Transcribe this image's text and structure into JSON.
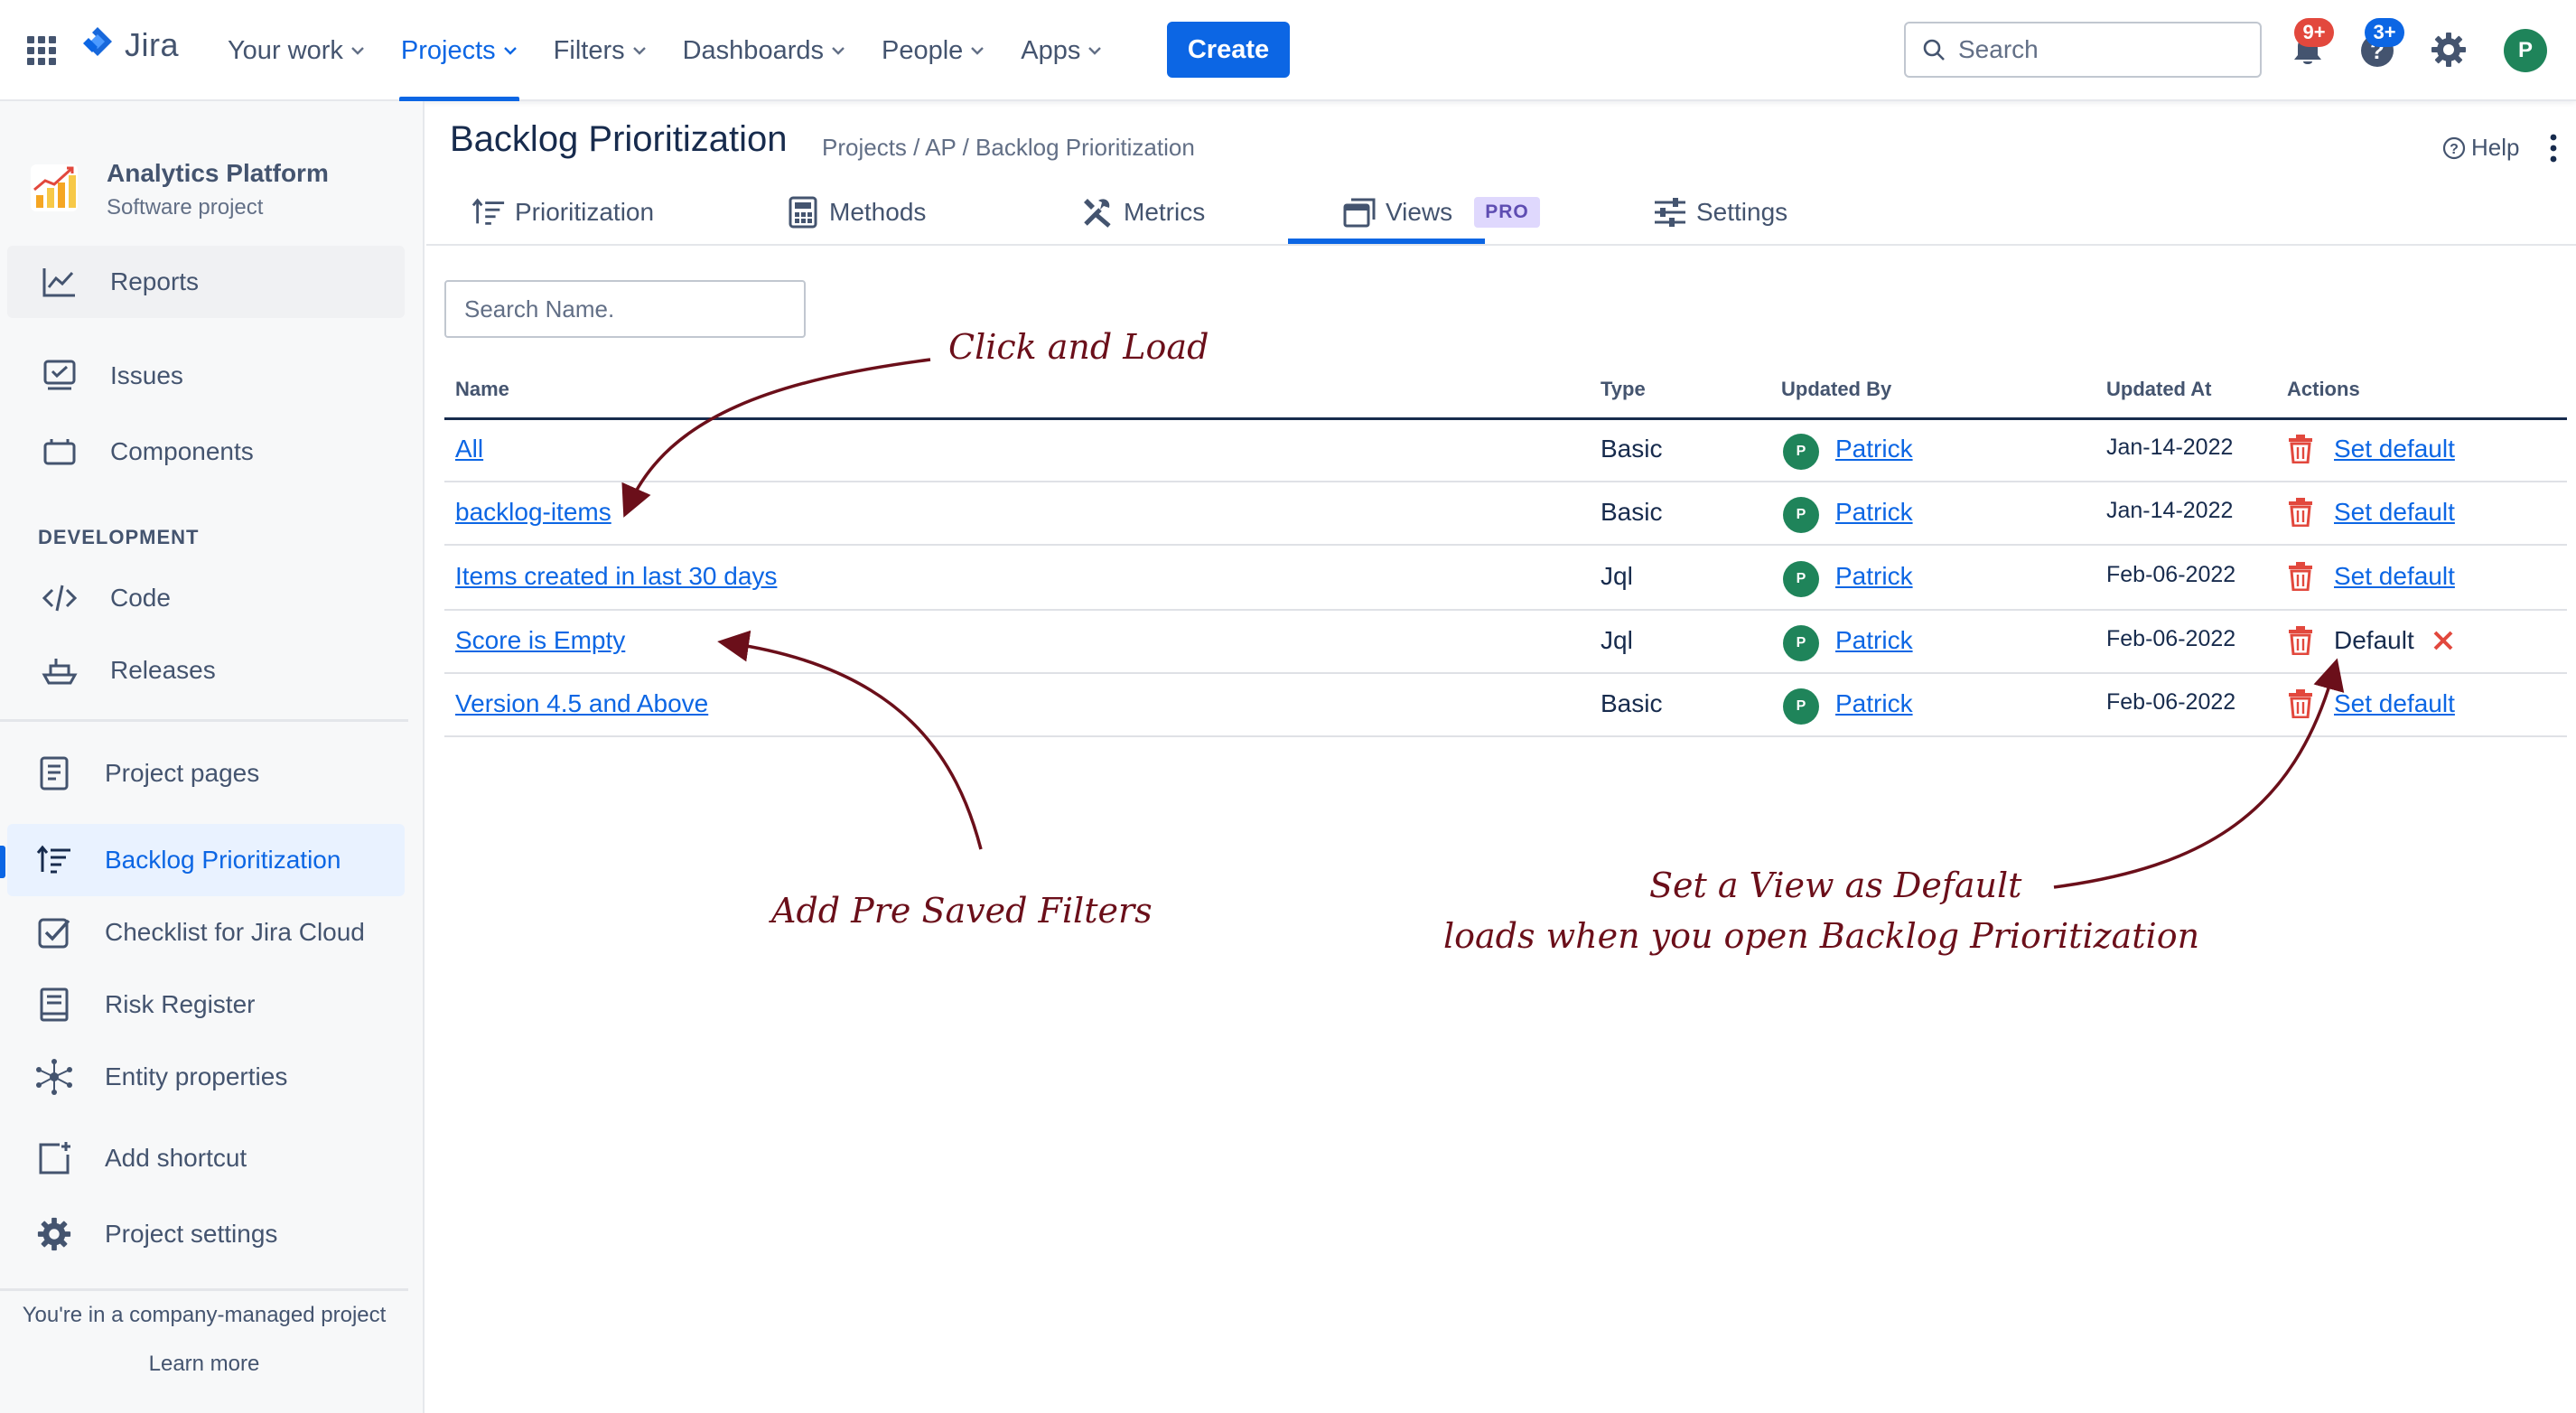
{
  "topnav": {
    "logo_text": "Jira",
    "menu": [
      {
        "label": "Your work"
      },
      {
        "label": "Projects"
      },
      {
        "label": "Filters"
      },
      {
        "label": "Dashboards"
      },
      {
        "label": "People"
      },
      {
        "label": "Apps"
      }
    ],
    "create_label": "Create",
    "search_placeholder": "Search",
    "notifications_badge": "9+",
    "help_badge": "3+",
    "avatar_initial": "P"
  },
  "sidebar": {
    "project_name": "Analytics Platform",
    "project_type": "Software project",
    "items_top": [
      {
        "label": "Reports",
        "icon": "chart-line-icon"
      },
      {
        "label": "Issues",
        "icon": "issues-icon"
      },
      {
        "label": "Components",
        "icon": "components-icon"
      }
    ],
    "section_heading": "DEVELOPMENT",
    "items_dev": [
      {
        "label": "Code",
        "icon": "code-icon"
      },
      {
        "label": "Releases",
        "icon": "ship-icon"
      }
    ],
    "items_apps": [
      {
        "label": "Project pages",
        "icon": "page-icon"
      },
      {
        "label": "Backlog Prioritization",
        "icon": "sort-icon"
      },
      {
        "label": "Checklist for Jira Cloud",
        "icon": "checklist-icon"
      },
      {
        "label": "Risk Register",
        "icon": "book-icon"
      },
      {
        "label": "Entity properties",
        "icon": "network-icon"
      },
      {
        "label": "Add shortcut",
        "icon": "add-shortcut-icon"
      },
      {
        "label": "Project settings",
        "icon": "gear-icon"
      }
    ],
    "footer_text": "You're in a company-managed project",
    "footer_link": "Learn more"
  },
  "main": {
    "title": "Backlog Prioritization",
    "breadcrumb": "Projects / AP / Backlog Prioritization",
    "help_label": "Help",
    "tabs": [
      {
        "label": "Prioritization"
      },
      {
        "label": "Methods"
      },
      {
        "label": "Metrics"
      },
      {
        "label": "Views",
        "badge": "PRO"
      },
      {
        "label": "Settings"
      }
    ],
    "search_placeholder": "Search Name.",
    "table": {
      "headers": [
        "Name",
        "Type",
        "Updated By",
        "Updated At",
        "Actions"
      ],
      "rows": [
        {
          "name": "All",
          "type": "Basic",
          "updated_by": "Patrick",
          "updated_at": "Jan-14-2022",
          "action": "Set default"
        },
        {
          "name": "backlog-items",
          "type": "Basic",
          "updated_by": "Patrick",
          "updated_at": "Jan-14-2022",
          "action": "Set default"
        },
        {
          "name": "Items created in last 30 days",
          "type": "Jql",
          "updated_by": "Patrick",
          "updated_at": "Feb-06-2022",
          "action": "Set default"
        },
        {
          "name": "Score is Empty",
          "type": "Jql",
          "updated_by": "Patrick",
          "updated_at": "Feb-06-2022",
          "action": "Default"
        },
        {
          "name": "Version 4.5 and Above",
          "type": "Basic",
          "updated_by": "Patrick",
          "updated_at": "Feb-06-2022",
          "action": "Set default"
        }
      ],
      "avatar_initial": "P"
    }
  },
  "annotations": {
    "click_load": "Click and Load",
    "add_filters": "Add Pre Saved Filters",
    "set_default_1": "Set a View as Default",
    "set_default_2": "loads when you open Backlog Prioritization"
  },
  "colors": {
    "brand_blue": "#0c66e4",
    "annotation": "#6b0f1a",
    "delete_red": "#e2483d",
    "avatar_green": "#1f845a"
  }
}
